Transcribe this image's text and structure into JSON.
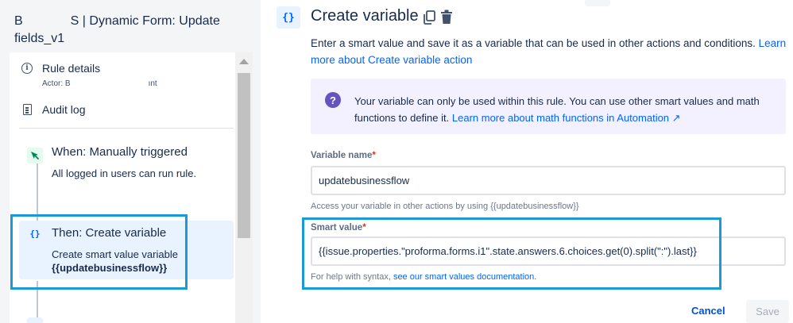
{
  "left": {
    "rule_title_prefix": "B",
    "rule_title_rest": "S | Dynamic Form: Update fields_v1",
    "rule_details": {
      "label": "Rule details",
      "actor": "Actor: B",
      "actor_tail": "ınt"
    },
    "audit_log": {
      "label": "Audit log"
    },
    "trigger": {
      "title": "When: Manually triggered",
      "desc": "All logged in users can run rule."
    },
    "action": {
      "title": "Then: Create variable",
      "desc": "Create smart value variable",
      "variable": "{{updatebusinessflow}}",
      "icon_text": "{}"
    }
  },
  "right": {
    "header": {
      "icon_text": "{}",
      "title": "Create variable"
    },
    "intro_text": "Enter a smart value and save it as a variable that can be used in other actions and conditions.",
    "intro_link": "Learn more about Create variable action",
    "notice": {
      "icon_text": "?",
      "text": "Your variable can only be used within this rule. You can use other smart values and math functions to define it.",
      "link": "Learn more about math functions in Automation ↗"
    },
    "variable_name": {
      "label": "Variable name",
      "required_mark": "*",
      "value": "updatebusinessflow",
      "helper": "Access your variable in other actions by using {{updatebusinessflow}}"
    },
    "smart_value": {
      "label": "Smart value",
      "required_mark": "*",
      "value": "{{issue.properties.\"proforma.forms.i1\".state.answers.6.choices.get(0).split(\":\").last}}",
      "helper_prefix": "For help with syntax,",
      "helper_link": "see our smart values documentation."
    },
    "buttons": {
      "cancel": "Cancel",
      "save": "Save"
    }
  },
  "colors": {
    "accent": "#0065ff",
    "highlight": "#1a9bd7",
    "notice_bg": "#f3f0ff",
    "notice_icon": "#6554c0",
    "required": "#de350b"
  },
  "icons": {
    "rule_details": "info-icon",
    "audit_log": "document-icon",
    "trigger": "cursor-click-icon",
    "action": "braces-icon",
    "copy": "copy-icon",
    "delete": "trash-icon",
    "notice": "question-icon"
  }
}
